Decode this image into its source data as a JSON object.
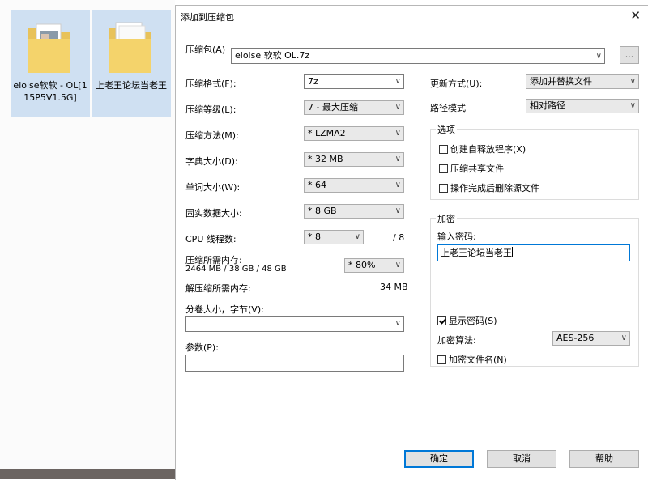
{
  "desktop": {
    "icons": [
      {
        "label": "eloise软软 - OL[115P5V1.5G]"
      },
      {
        "label": "上老王论坛当老王"
      }
    ]
  },
  "dialog": {
    "title": "添加到压缩包",
    "close_glyph": "✕",
    "archive": {
      "label": "压缩包(A)",
      "value": "eloise 软软 OL.7z",
      "browse_label": "..."
    },
    "left": {
      "format": {
        "label": "压缩格式(F):",
        "value": "7z"
      },
      "level": {
        "label": "压缩等级(L):",
        "value": "7 - 最大压缩"
      },
      "method": {
        "label": "压缩方法(M):",
        "value": "* LZMA2"
      },
      "dict": {
        "label": "字典大小(D):",
        "value": "* 32 MB"
      },
      "word": {
        "label": "单词大小(W):",
        "value": "* 64"
      },
      "solid": {
        "label": "固实数据大小:",
        "value": "* 8 GB"
      },
      "cpu": {
        "label": "CPU 线程数:",
        "value": "* 8",
        "max": "/ 8"
      },
      "mem_comp": {
        "label": "压缩所需内存:",
        "detail": "2464 MB / 38 GB / 48 GB",
        "value": "* 80%"
      },
      "mem_decomp": {
        "label": "解压缩所需内存:",
        "value": "34 MB"
      },
      "split": {
        "label": "分卷大小，字节(V):",
        "value": ""
      },
      "params": {
        "label": "参数(P):",
        "value": ""
      }
    },
    "right": {
      "update": {
        "label": "更新方式(U):",
        "value": "添加并替换文件"
      },
      "path": {
        "label": "路径模式",
        "value": "相对路径"
      },
      "options": {
        "title": "选项",
        "items": [
          {
            "label": "创建自释放程序(X)"
          },
          {
            "label": "压缩共享文件"
          },
          {
            "label": "操作完成后删除源文件"
          }
        ]
      },
      "encryption": {
        "title": "加密",
        "pwd_label": "输入密码:",
        "pwd_value": "上老王论坛当老王",
        "show_pwd": "显示密码(S)",
        "algo_label": "加密算法:",
        "algo_value": "AES-256",
        "encrypt_names": "加密文件名(N)"
      }
    },
    "buttons": {
      "ok": "确定",
      "cancel": "取消",
      "help": "帮助"
    }
  }
}
